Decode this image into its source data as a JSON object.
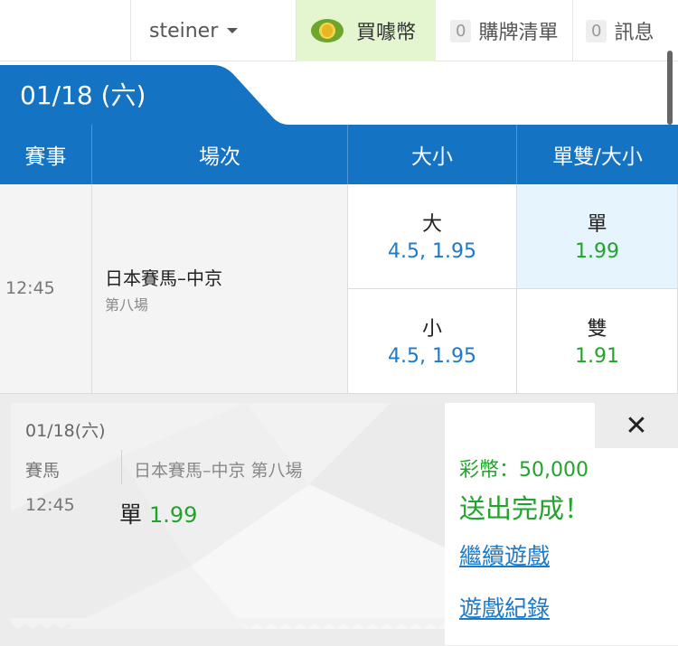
{
  "topbar": {
    "username": "steiner",
    "buy_label": "買噱幣",
    "cart_count": "0",
    "cart_label": "購牌清單",
    "msg_count": "0",
    "msg_label": "訊息"
  },
  "date_tab": "01/18 (六)",
  "table": {
    "headers": [
      "賽事",
      "場次",
      "大小",
      "單雙/大小"
    ],
    "time": "12:45",
    "match_name": "日本賽馬–中京",
    "race_no": "第八場",
    "odds": [
      {
        "label": "大",
        "value": "4.5, 1.95"
      },
      {
        "label": "單",
        "value": "1.99"
      },
      {
        "label": "小",
        "value": "4.5, 1.95"
      },
      {
        "label": "雙",
        "value": "1.91"
      }
    ]
  },
  "ticket": {
    "date": "01/18(六)",
    "sport": "賽馬",
    "match": "日本賽馬–中京 第八場",
    "time": "12:45",
    "pick": "單",
    "odds": "1.99"
  },
  "result": {
    "coins": "彩幣：50,000",
    "status": "送出完成！",
    "continue_link": "繼續遊戲",
    "history_link": "遊戲紀錄",
    "close": "✕"
  },
  "colors": {
    "primary_blue": "#1573c3",
    "odds_blue": "#1b7ac9",
    "odds_green": "#22a32b",
    "buy_bg": "#e3f6cf",
    "selected_bg": "#e6f4fd"
  }
}
